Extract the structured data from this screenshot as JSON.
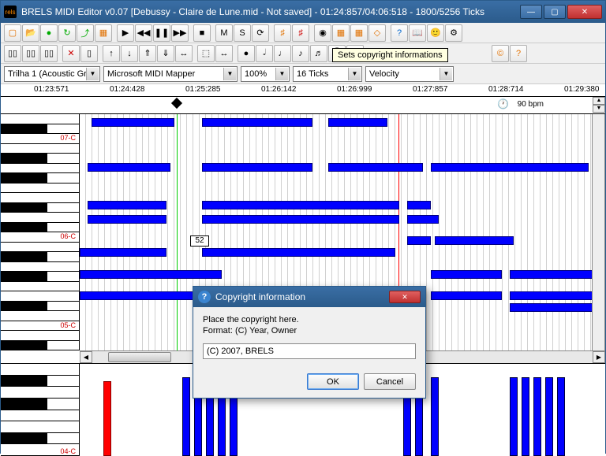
{
  "window": {
    "app_icon_text": "rels",
    "title": "BRELS MIDI Editor v0.07 [Debussy - Claire de Lune.mid - Not saved] - 01:24:857/04:06:518 - 1800/5256 Ticks"
  },
  "toolbar1": {
    "new": "▢",
    "open": "📂",
    "save": "●",
    "reload": "↻",
    "export": "⤴",
    "grid": "▦",
    "play": "▶",
    "rew": "◀◀",
    "pause": "❚❚",
    "ff": "▶▶",
    "stop": "■",
    "M": "M",
    "S": "S",
    "loop": "⟳",
    "mixer": "♯",
    "mixer2": "♯",
    "rec": "◉",
    "sel1": "▦",
    "sel2": "▦",
    "eraser": "◇",
    "help": "?",
    "info": "📖",
    "about": "🙂",
    "pref": "⚙"
  },
  "toolbar2": {
    "b1": "▯▯",
    "b2": "▯▯",
    "b3": "▯▯",
    "del": "✕",
    "copy": "▯",
    "up": "↑",
    "down": "↓",
    "up2": "⇑",
    "down2": "⇓",
    "ext": "↔",
    "selrect": "⬚",
    "pan": "↔",
    "whole": "●",
    "half": "𝅗𝅥",
    "quarter": "♩",
    "eighth": "♪",
    "sixteenth": "♬",
    "tie": "⁀",
    "rest": "𝄽",
    "copyright": "©",
    "q": "?",
    "tooltip_text": "Sets copyright informations"
  },
  "combos": {
    "track": "Trilha 1 (Acoustic Grar",
    "device": "Microsoft MIDI Mapper",
    "zoom": "100%",
    "snap": "16 Ticks",
    "param": "Velocity"
  },
  "ruler": {
    "marks": [
      "01:23:571",
      "01:24:428",
      "01:25:285",
      "01:26:142",
      "01:26:999",
      "01:27:857",
      "01:28:714",
      "01:29:380"
    ]
  },
  "tempo": {
    "label": "90 bpm",
    "clock": "🕐"
  },
  "octaves": {
    "a": "07-C",
    "b": "06-C",
    "c": "05-C",
    "d": "04-C"
  },
  "cursor_box": "52",
  "dialog": {
    "title": "Copyright information",
    "line1": "Place the copyright here.",
    "line2": "Format: (C) Year, Owner",
    "value": "(C) 2007, BRELS",
    "ok": "OK",
    "cancel": "Cancel"
  }
}
